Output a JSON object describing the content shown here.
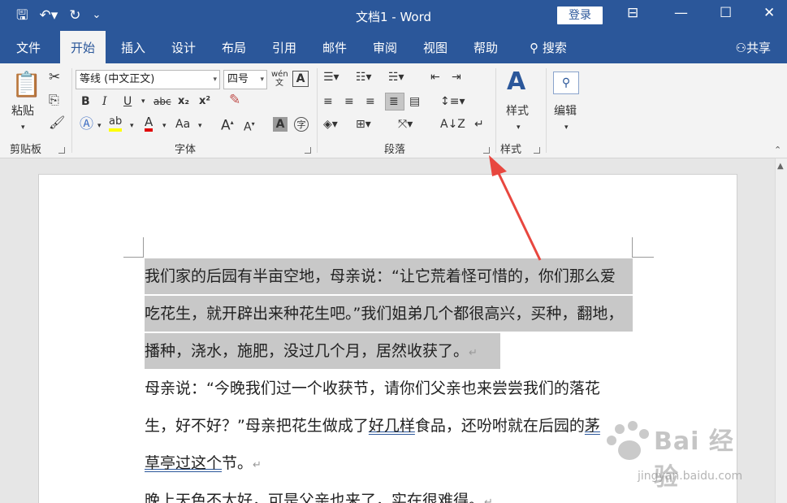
{
  "app": {
    "document_name": "文档1",
    "separator": " - ",
    "app_name": "Word",
    "login_label": "登录"
  },
  "tabs": [
    {
      "label": "文件"
    },
    {
      "label": "开始"
    },
    {
      "label": "插入"
    },
    {
      "label": "设计"
    },
    {
      "label": "布局"
    },
    {
      "label": "引用"
    },
    {
      "label": "邮件"
    },
    {
      "label": "审阅"
    },
    {
      "label": "视图"
    },
    {
      "label": "帮助"
    },
    {
      "label": "搜索"
    }
  ],
  "active_tab": "开始",
  "share_label": "共享",
  "ribbon": {
    "clipboard": {
      "paste_label": "粘贴",
      "group_label": "剪贴板"
    },
    "font": {
      "font_name": "等线 (中文正文)",
      "font_size": "四号",
      "phonetic_label": "wén 文",
      "group_label": "字体",
      "bold": "B",
      "italic": "I",
      "underline": "U",
      "strike": "abc",
      "sub": "x₂",
      "sup": "x²",
      "grow": "A",
      "shrink": "A",
      "case": "Aa"
    },
    "paragraph": {
      "group_label": "段落"
    },
    "styles": {
      "label": "样式",
      "group_label": "样式"
    },
    "editing": {
      "label": "编辑"
    }
  },
  "document": {
    "lines": [
      {
        "text": "我们家的后园有半亩空地，母亲说：“让它荒着怪可惜的，你们那么爱",
        "selected": true
      },
      {
        "text": "吃花生，就开辟出来种花生吧。”我们姐弟几个都很高兴，买种，翻地，",
        "selected": true
      },
      {
        "text": "播种，浇水，施肥，没过几个月，居然收获了。",
        "selected": true,
        "mark": "↵"
      },
      {
        "text": "母亲说：“今晚我们过一个收获节，请你们父亲也来尝尝我们的落花",
        "selected": false
      },
      {
        "part1": "生，好不好？”母亲把花生做成了",
        "underlined": "好几样",
        "part2": "食品，还吩咐就在后园的",
        "underlined2": "茅"
      },
      {
        "underlined": "草亭过这个",
        "part2": "节。",
        "mark": "↵"
      },
      {
        "text": "晚上天色不太好，可是父亲也来了，实在很难得。",
        "mark": "↵"
      }
    ]
  },
  "watermark": {
    "brand": "Bai 经验",
    "url": "jingyan.baidu.com"
  },
  "colors": {
    "accent": "#2b579a",
    "arrow": "#e8473f",
    "selection": "#c8c8c8"
  }
}
